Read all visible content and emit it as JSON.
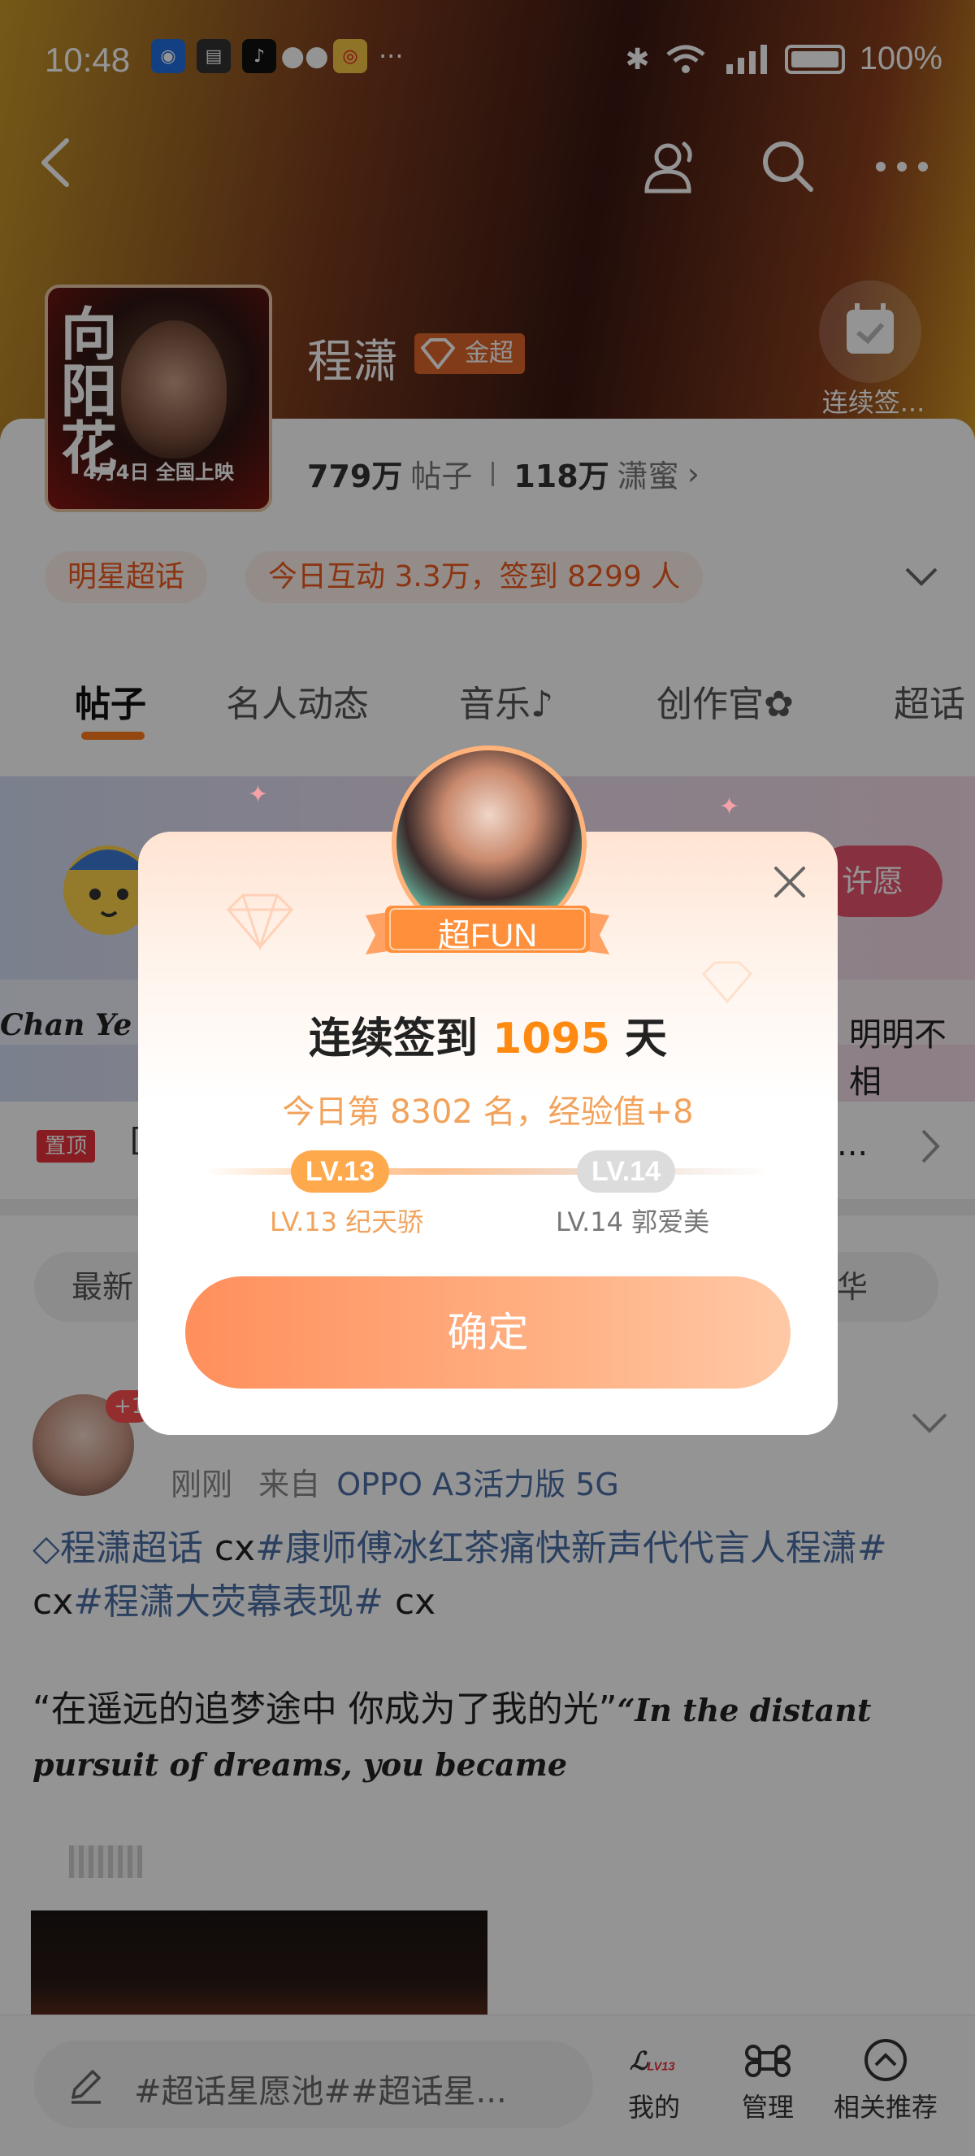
{
  "status_bar": {
    "time": "10:48",
    "battery": "100%",
    "overflow": "···"
  },
  "nav": {
    "back_icon": "chevron-left-icon",
    "icons": [
      "contacts-icon",
      "search-icon",
      "more-icon"
    ]
  },
  "topic": {
    "name": "程潇",
    "badge": "金超",
    "cover": {
      "title": "向阳花",
      "date": "4月4日 全国上映"
    },
    "posts_count": "779万",
    "posts_label": "帖子",
    "fans_count": "118万",
    "fans_label": "潇蜜",
    "checkin_label": "连续签...",
    "chips": [
      "明星超话",
      "今日互动 3.3万，签到 8299 人"
    ]
  },
  "tabs": [
    "帖子",
    "名人动态",
    "音乐",
    "创作官",
    "超话"
  ],
  "banner": {
    "wish_button": "许愿",
    "strip_left": "Chan Ye is",
    "strip_right": "明明不相"
  },
  "pinned": {
    "badge": "置顶",
    "text": "[",
    "ellipsis": "..."
  },
  "sort": {
    "left": "最新",
    "right": "华"
  },
  "post": {
    "badge": "+1",
    "time": "刚刚",
    "source_prefix": "来自",
    "device": "OPPO A3活力版 5G",
    "topic_link": "程潇超话",
    "text_1": " cx",
    "tag_1": "#康师傅冰红茶痛快新声代代言人程潇#",
    "text_2": " cx",
    "tag_2": "#程潇大荧幕表现#",
    "text_3": " cx",
    "quote_cn": "“在遥远的追梦途中 你成为了我的光”",
    "quote_en": "“In the distant pursuit of dreams, you became"
  },
  "bottom_bar": {
    "composer_placeholder": "#超话星愿池##超话星...",
    "level_badge": "LV13",
    "items": [
      "我的",
      "管理",
      "相关推荐"
    ]
  },
  "dialog": {
    "ribbon_label": "超FUN",
    "title_prefix": "连续签到 ",
    "days": "1095",
    "title_suffix": " 天",
    "subtitle": "今日第 8302 名，经验值+8",
    "current_level": "LV.13",
    "current_level_name": "LV.13 纪天骄",
    "next_level": "LV.14",
    "next_level_name": "LV.14 郭爱美",
    "confirm_button": "确定"
  },
  "colors": {
    "accent_orange": "#ff8a12",
    "tag_blue": "#4a6fa5",
    "pin_red": "#e8323b",
    "confirm_gradient_start": "#ff8f5c"
  }
}
